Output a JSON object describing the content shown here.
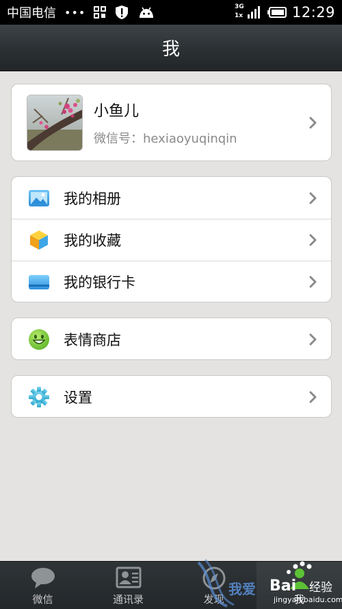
{
  "status_bar": {
    "carrier": "中国电信",
    "dots": "•••",
    "network": "3G",
    "network_sub": "1x",
    "time": "12:29"
  },
  "header": {
    "title": "我"
  },
  "profile": {
    "nickname": "小鱼儿",
    "wechat_id": "微信号：hexiaoyuqinqin"
  },
  "menu_group_1": [
    {
      "label": "我的相册",
      "icon": "photo-album-icon"
    },
    {
      "label": "我的收藏",
      "icon": "favorites-cube-icon"
    },
    {
      "label": "我的银行卡",
      "icon": "bank-card-icon"
    }
  ],
  "menu_group_2": [
    {
      "label": "表情商店",
      "icon": "emoji-smile-icon"
    }
  ],
  "menu_group_3": [
    {
      "label": "设置",
      "icon": "gear-icon"
    }
  ],
  "tabs": [
    {
      "label": "微信",
      "icon": "chat-bubble-icon",
      "active": false
    },
    {
      "label": "通讯录",
      "icon": "contact-card-icon",
      "active": false
    },
    {
      "label": "发现",
      "icon": "compass-icon",
      "active": false
    },
    {
      "label": "我",
      "icon": "person-icon",
      "active": true
    }
  ],
  "watermark": {
    "text_a": "我爱",
    "text_b": "Bai",
    "text_c": "经验",
    "url": "jingyan.baidu.com"
  },
  "colors": {
    "background": "#e4e3e1",
    "title_bar": "#2b3033",
    "card_border": "#c9c9c9",
    "secondary_text": "#8a8a8a"
  }
}
